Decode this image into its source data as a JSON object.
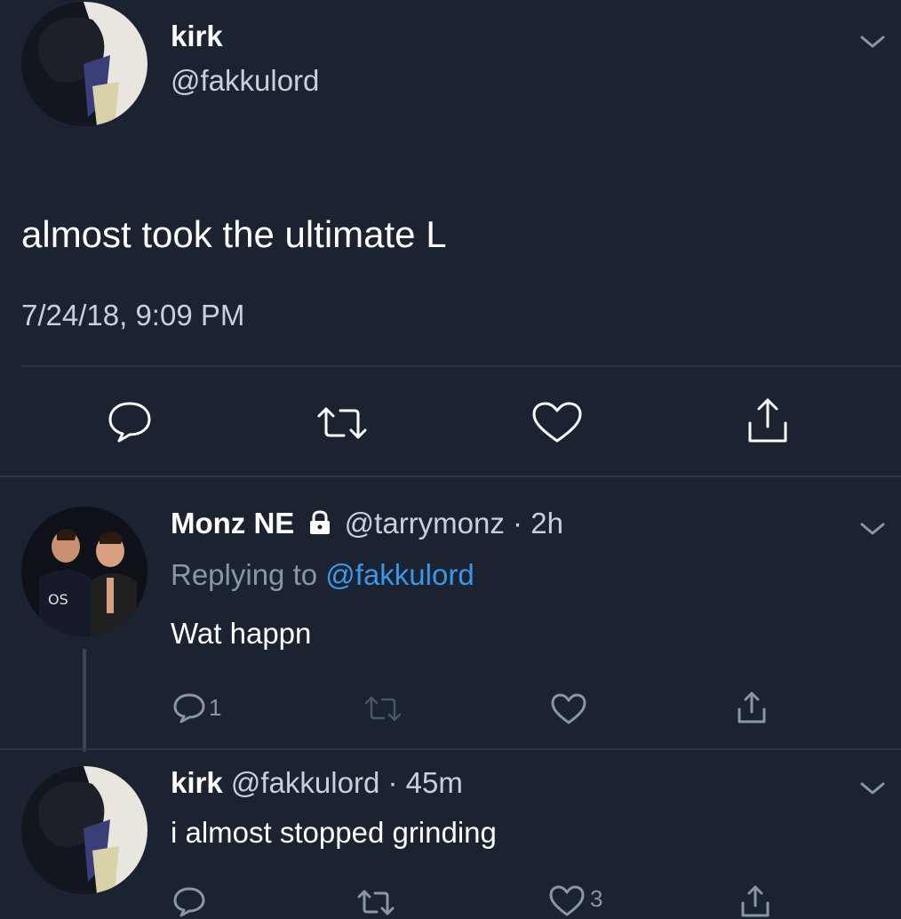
{
  "main_tweet": {
    "display_name": "kirk",
    "handle": "@fakkulord",
    "text": "almost took the ultimate L",
    "timestamp": "7/24/18, 9:09 PM"
  },
  "replies": [
    {
      "display_name": "Monz NE",
      "handle": "@tarrymonz",
      "separator": "·",
      "time": "2h",
      "protected": true,
      "replying_prefix": "Replying to",
      "replying_to": "@fakkulord",
      "text": "Wat happn",
      "reply_count": "1"
    },
    {
      "display_name": "kirk",
      "handle": "@fakkulord",
      "separator": "·",
      "time": "45m",
      "text": "i almost stopped grinding",
      "like_count": "3"
    }
  ],
  "icons": {
    "reply": "comment-icon",
    "retweet": "retweet-icon",
    "like": "heart-icon",
    "share": "share-icon",
    "more": "chevron-down-icon",
    "lock": "lock-icon"
  },
  "colors": {
    "background": "#1b2230",
    "text": "#ffffff",
    "muted": "#8a96a8",
    "link": "#3a97e8"
  }
}
